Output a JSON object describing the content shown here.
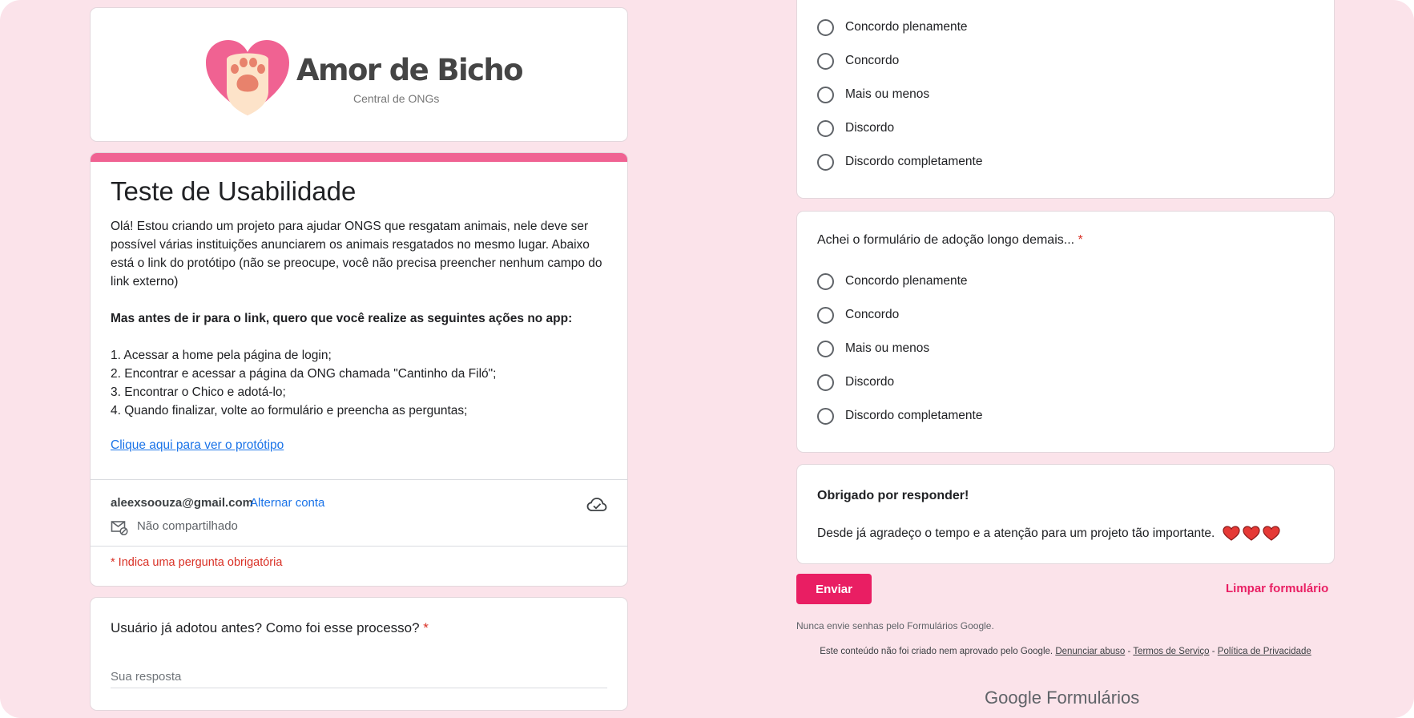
{
  "logo": {
    "title": "Amor de Bicho",
    "subtitle": "Central de ONGs"
  },
  "intro": {
    "title": "Teste de Usabilidade",
    "paragraph": "Olá! Estou criando um projeto para ajudar ONGS que resgatam animais, nele deve ser possível várias instituições anunciarem os animais resgatados no mesmo lugar. Abaixo está o link do protótipo (não se preocupe, você não precisa preencher nenhum campo do link externo)",
    "bold_line": "Mas antes de ir para o link, quero que você realize as seguintes ações no app:",
    "steps": [
      "1. Acessar a home pela página de login;",
      "2. Encontrar e acessar a página da ONG chamada \"Cantinho da Filó\";",
      "3. Encontrar o Chico e adotá-lo;",
      "4. Quando finalizar, volte ao formulário e preencha as perguntas;"
    ],
    "link_text": "Clique aqui para ver o protótipo"
  },
  "account": {
    "email": "aleexsoouza@gmail.com",
    "switch_label": "Alternar conta",
    "share_status": "Não compartilhado",
    "cloud_icon": "cloud-done-icon",
    "share_icon": "mail-not-shared-icon"
  },
  "required_note": "* Indica uma pergunta obrigatória",
  "question1": {
    "title": "Usuário já adotou antes? Como foi esse processo?",
    "required_mark": "*",
    "placeholder": "Sua resposta"
  },
  "question_prev": {
    "options": [
      "Concordo plenamente",
      "Concordo",
      "Mais ou menos",
      "Discordo",
      "Discordo completamente"
    ]
  },
  "question2": {
    "title": "Achei o formulário de adoção longo demais...",
    "required_mark": "*",
    "options": [
      "Concordo plenamente",
      "Concordo",
      "Mais ou menos",
      "Discordo",
      "Discordo completamente"
    ]
  },
  "thanks": {
    "title": "Obrigado por responder!",
    "text": "Desde já agradeço o tempo e a atenção para um projeto tão importante.",
    "icon": "heart-icon"
  },
  "footer": {
    "submit_label": "Enviar",
    "clear_label": "Limpar formulário",
    "never_send": "Nunca envie senhas pelo Formulários Google.",
    "disclaimer_prefix": "Este conteúdo não foi criado nem aprovado pelo Google.",
    "report_abuse": "Denunciar abuso",
    "sep1": "-",
    "terms": "Termos de Serviço",
    "sep2": "-",
    "privacy": "Política de Privacidade",
    "brand_google": "Google",
    "brand_forms": "Formulários"
  },
  "colors": {
    "background": "#fbe3ea",
    "accent": "#e91e63",
    "header_bar": "#f06292",
    "required": "#d93025",
    "link": "#1a73e8"
  }
}
